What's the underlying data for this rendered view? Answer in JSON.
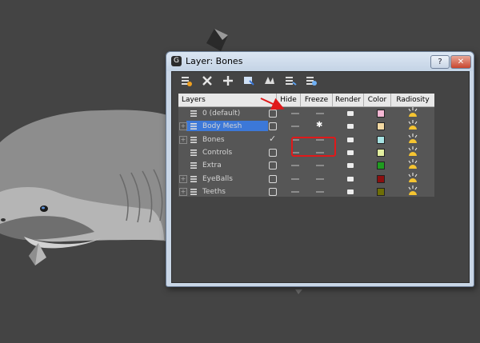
{
  "window": {
    "title": "Layer: Bones",
    "help_label": "?",
    "close_label": "✕"
  },
  "toolbar": {
    "tools": [
      {
        "icon": "new-layer-icon"
      },
      {
        "icon": "delete-icon"
      },
      {
        "icon": "add-to-layer-icon"
      },
      {
        "icon": "select-objects-icon"
      },
      {
        "icon": "select-layer-icon"
      },
      {
        "icon": "set-current-icon"
      },
      {
        "icon": "hide-freeze-all-icon"
      }
    ]
  },
  "columns": {
    "layers": "Layers",
    "hide": "Hide",
    "freeze": "Freeze",
    "render": "Render",
    "color": "Color",
    "radiosity": "Radiosity"
  },
  "layers": [
    {
      "name": "0 (default)",
      "expandable": false,
      "selected": false,
      "current": false,
      "frozen": false,
      "color": "#f5b8d4"
    },
    {
      "name": "Body Mesh",
      "expandable": true,
      "selected": true,
      "current": false,
      "frozen": true,
      "color": "#f3d9a3"
    },
    {
      "name": "Bones",
      "expandable": true,
      "selected": false,
      "current": true,
      "frozen": false,
      "color": "#a7e3e3"
    },
    {
      "name": "Controls",
      "expandable": false,
      "selected": false,
      "current": false,
      "frozen": false,
      "color": "#e3efa0"
    },
    {
      "name": "Extra",
      "expandable": false,
      "selected": false,
      "current": false,
      "frozen": false,
      "color": "#1f9b1f"
    },
    {
      "name": "EyeBalls",
      "expandable": true,
      "selected": false,
      "current": false,
      "frozen": false,
      "color": "#8b0f0f"
    },
    {
      "name": "Teeths",
      "expandable": true,
      "selected": false,
      "current": false,
      "frozen": false,
      "color": "#6e6e06"
    }
  ],
  "colors": {
    "background": "#444444",
    "selection": "#3c78d8",
    "annotation": "#e0191a"
  }
}
